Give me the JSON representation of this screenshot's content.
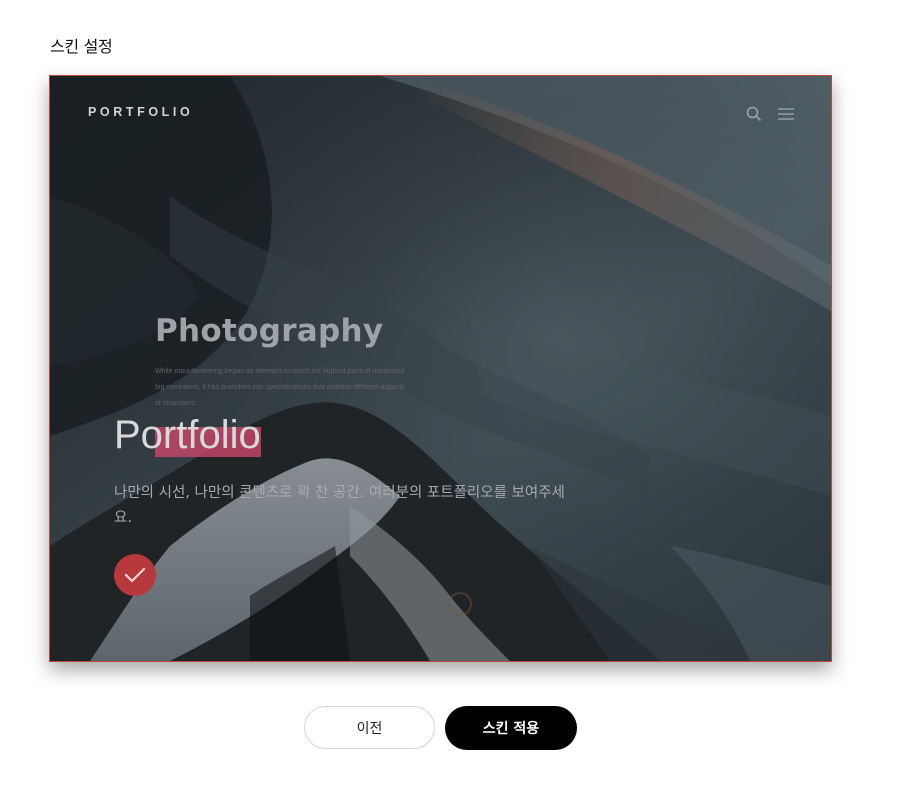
{
  "page": {
    "title": "스킨 설정"
  },
  "preview": {
    "brand": "PORTFOLIO",
    "icons": [
      "search-icon",
      "menu-icon"
    ],
    "photo_heading": "Photography",
    "photo_desc": "While mountaineering began as attempts to reach the highest point of unclimbed big mountains, it has branched into specializations that address different aspects of mountains.",
    "skin_name": "Portfolio",
    "skin_description": "나만의 시선, 나만의 콘텐츠로 꽉 찬 공간. 여러분의 포트폴리오를 보여주세요.",
    "selected_icon": "check-icon",
    "colors": {
      "accent_highlight": "#c14566",
      "selected_badge": "#b7393c",
      "border": "#b84a3a"
    }
  },
  "actions": {
    "prev_label": "이전",
    "apply_label": "스킨 적용"
  }
}
